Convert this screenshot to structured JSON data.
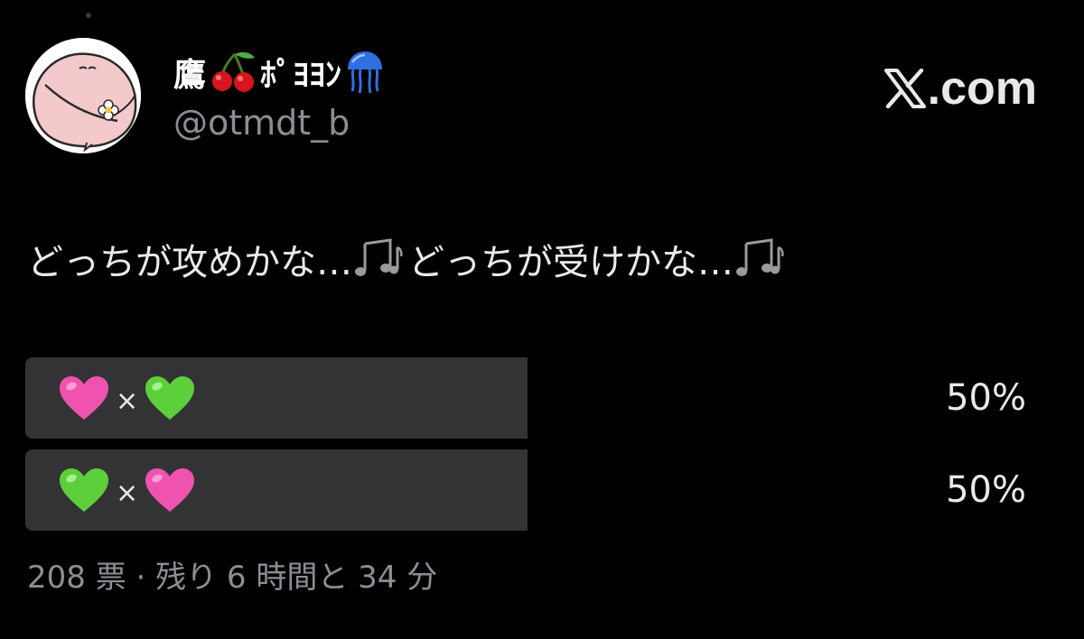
{
  "author": {
    "name_parts": [
      "鷹",
      "ﾎﾟﾖﾖﾝ"
    ],
    "name_icons": [
      "cherries-icon",
      "jellyfish-icon"
    ],
    "handle": "@otmdt_b"
  },
  "brand": {
    "label": ".com",
    "icon": "x-logo-icon"
  },
  "tweet": {
    "text_part1": "どっちが攻めかな…",
    "text_part2": "どっちが受けかな…",
    "icon": "music-notes-icon"
  },
  "poll": {
    "options": [
      {
        "left_icon": "pink-heart-icon",
        "separator": "×",
        "right_icon": "green-heart-icon",
        "percent_label": "50%",
        "fraction": 0.5
      },
      {
        "left_icon": "green-heart-icon",
        "separator": "×",
        "right_icon": "pink-heart-icon",
        "percent_label": "50%",
        "fraction": 0.5
      }
    ],
    "footer": "208 票 · 残り 6 時間と 34 分"
  },
  "colors": {
    "background": "#000000",
    "text": "#e7e9ea",
    "secondary_text": "#8b8f94",
    "poll_bar": "#333335",
    "pink_heart": "#f052b0",
    "green_heart": "#5ccf3b"
  }
}
